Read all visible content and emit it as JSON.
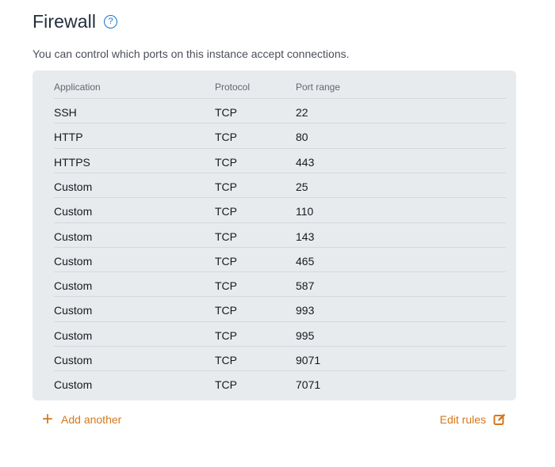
{
  "header": {
    "title": "Firewall",
    "help_icon": "question-circle-icon",
    "help_glyph": "?",
    "description": "You can control which ports on this instance accept connections."
  },
  "table": {
    "columns": [
      "Application",
      "Protocol",
      "Port range"
    ],
    "rows": [
      {
        "application": "SSH",
        "protocol": "TCP",
        "port": "22"
      },
      {
        "application": "HTTP",
        "protocol": "TCP",
        "port": "80"
      },
      {
        "application": "HTTPS",
        "protocol": "TCP",
        "port": "443"
      },
      {
        "application": "Custom",
        "protocol": "TCP",
        "port": "25"
      },
      {
        "application": "Custom",
        "protocol": "TCP",
        "port": "110"
      },
      {
        "application": "Custom",
        "protocol": "TCP",
        "port": "143"
      },
      {
        "application": "Custom",
        "protocol": "TCP",
        "port": "465"
      },
      {
        "application": "Custom",
        "protocol": "TCP",
        "port": "587"
      },
      {
        "application": "Custom",
        "protocol": "TCP",
        "port": "993"
      },
      {
        "application": "Custom",
        "protocol": "TCP",
        "port": "995"
      },
      {
        "application": "Custom",
        "protocol": "TCP",
        "port": "9071"
      },
      {
        "application": "Custom",
        "protocol": "TCP",
        "port": "7071"
      }
    ]
  },
  "actions": {
    "add_label": "Add another",
    "add_icon": "plus-icon",
    "edit_label": "Edit rules",
    "edit_icon": "edit-icon"
  },
  "colors": {
    "accent": "#d4781d",
    "link_blue": "#1a73c8",
    "panel_bg": "#e8ebed"
  }
}
